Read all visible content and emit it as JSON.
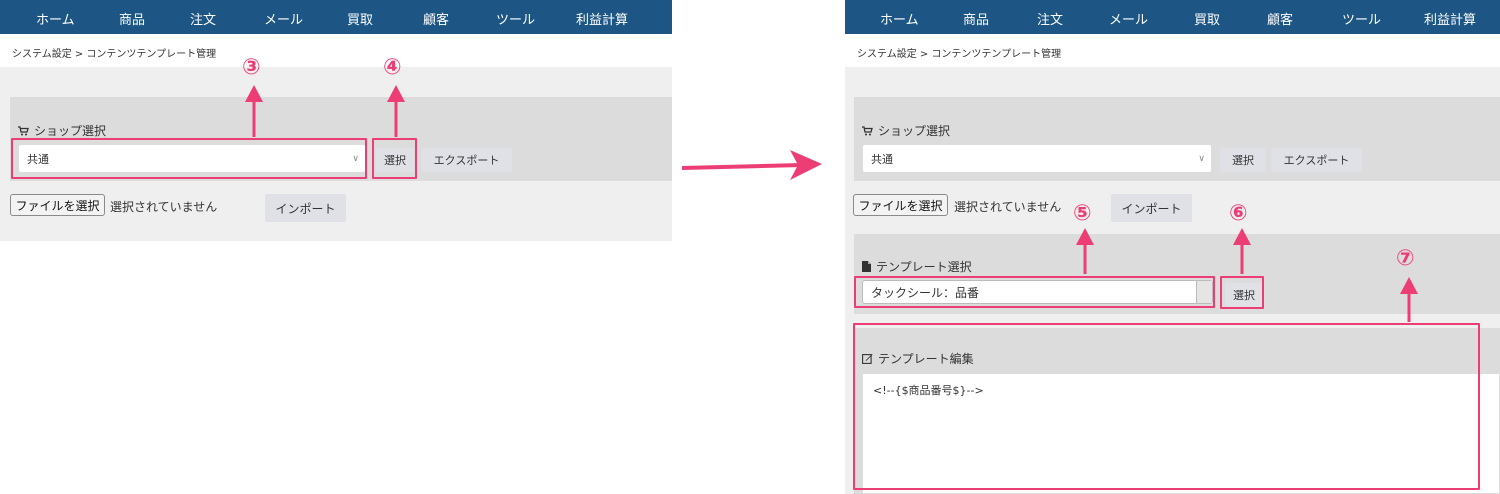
{
  "nav": {
    "items": [
      "ホーム",
      "商品",
      "注文",
      "メール",
      "買取",
      "顧客",
      "ツール",
      "利益計算"
    ]
  },
  "breadcrumb": "システム設定 > コンテンツテンプレート管理",
  "shop_section": {
    "label": "ショップ選択",
    "select_value": "共通",
    "select_button": "選択",
    "export_button": "エクスポート"
  },
  "import_section": {
    "file_button": "ファイルを選択",
    "file_status": "選択されていません",
    "import_button": "インポート"
  },
  "template_section": {
    "label": "テンプレート選択",
    "select_value": "タックシール：品番",
    "select_button": "選択"
  },
  "edit_section": {
    "label": "テンプレート編集",
    "content": "<!--{$商品番号$}-->"
  },
  "markers": {
    "m3": "③",
    "m4": "④",
    "m5": "⑤",
    "m6": "⑥",
    "m7": "⑦"
  },
  "colors": {
    "nav_bg": "#1d5684",
    "highlight": "#ec3e74"
  },
  "icons": [
    "cart-icon",
    "file-icon",
    "edit-icon",
    "chevron-down-icon",
    "arrow-right-icon"
  ]
}
